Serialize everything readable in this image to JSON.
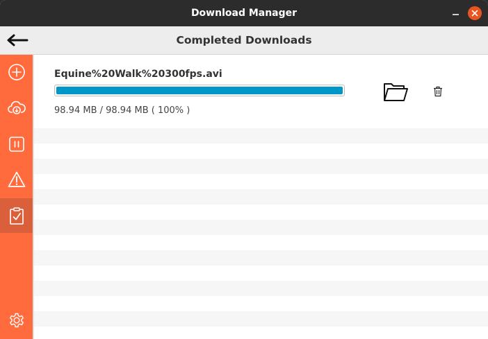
{
  "window": {
    "title": "Download Manager"
  },
  "header": {
    "title": "Completed Downloads"
  },
  "sidebar": {
    "items": [
      {
        "icon": "add-icon"
      },
      {
        "icon": "cloud-download-icon"
      },
      {
        "icon": "pause-icon"
      },
      {
        "icon": "warning-icon"
      },
      {
        "icon": "clipboard-check-icon",
        "active": true
      },
      {
        "icon": "gear-icon"
      }
    ]
  },
  "downloads": [
    {
      "filename": "Equine%20Walk%20300fps.avi",
      "size_text": "98.94 MB / 98.94 MB ( 100% )",
      "progress_percent": 100
    }
  ],
  "colors": {
    "sidebar": "#ff6b3d",
    "progress": "#0096c7",
    "close_button": "#e95420"
  }
}
